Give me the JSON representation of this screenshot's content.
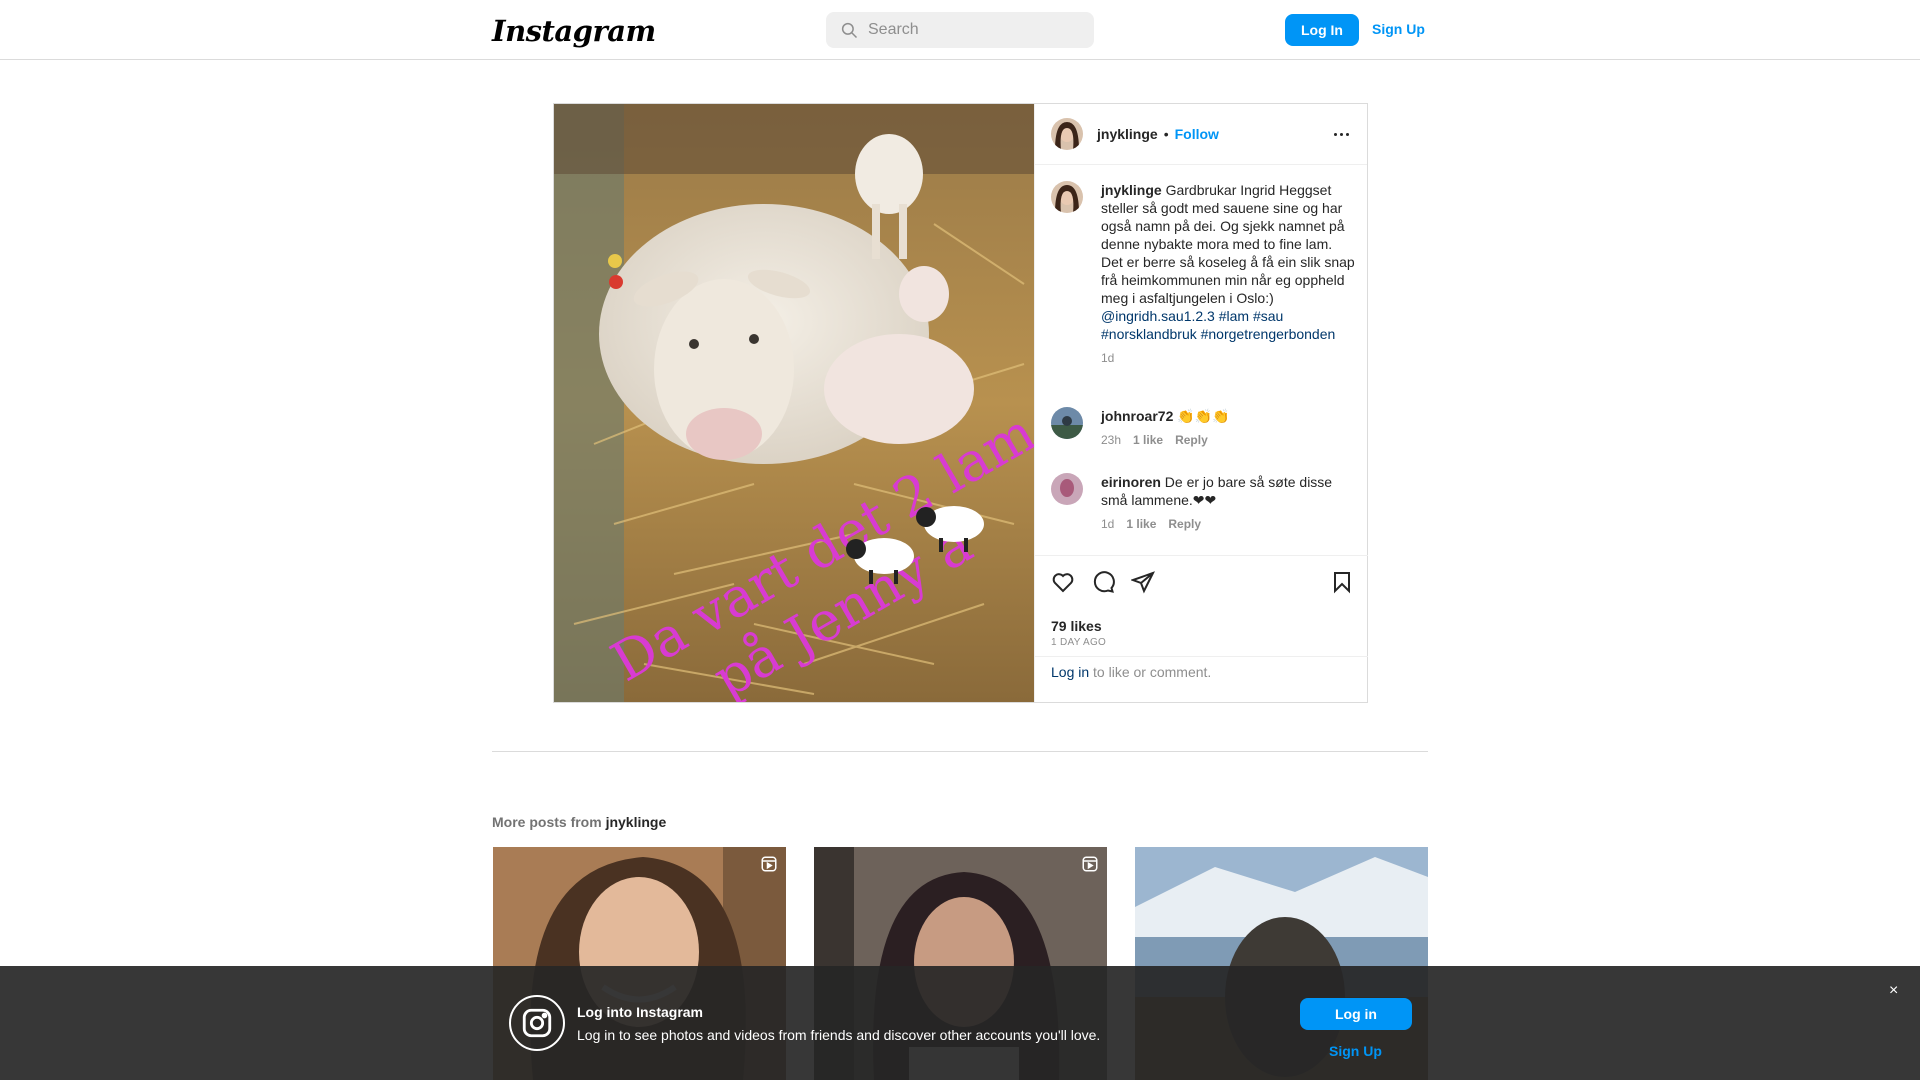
{
  "nav": {
    "logo": "Instagram",
    "search_placeholder": "Search",
    "login": "Log In",
    "signup": "Sign Up"
  },
  "post": {
    "image_overlay_line1": "Da vart det 2 lam",
    "image_overlay_line2": "på Jenny å",
    "author": "jnyklinge",
    "separator": "•",
    "follow": "Follow",
    "caption": {
      "user": "jnyklinge",
      "text": "Gardbrukar Ingrid Heggset steller så godt med sauene sine og har også namn på dei. Og sjekk namnet på denne nybakte mora med to fine lam. Det er berre så koseleg å få ein slik snap frå heimkommunen min når eg oppheld meg i asfaltjungelen i Oslo:)",
      "tags": "@ingridh.sau1.2.3 #lam #sau #norsklandbruk #norgetrengerbonden",
      "time": "1d"
    },
    "comments": [
      {
        "user": "johnroar72",
        "text": "👏👏👏",
        "time": "23h",
        "likes": "1 like",
        "reply": "Reply"
      },
      {
        "user": "eirinoren",
        "text": "De er jo bare så søte disse små lammene.❤❤",
        "time": "1d",
        "likes": "1 like",
        "reply": "Reply"
      }
    ],
    "likes": "79 likes",
    "ago": "1 DAY AGO",
    "login_link": "Log in",
    "login_rest": " to like or comment."
  },
  "more_posts": {
    "prefix": "More posts from ",
    "user": "jnyklinge"
  },
  "banner": {
    "title": "Log into Instagram",
    "text": "Log in to see photos and videos from friends and discover other accounts you'll love.",
    "login": "Log in",
    "signup": "Sign Up",
    "close": "×"
  },
  "colors": {
    "accent": "#0095f6",
    "link": "#00376b",
    "overlay_text": "#d83bd2"
  }
}
